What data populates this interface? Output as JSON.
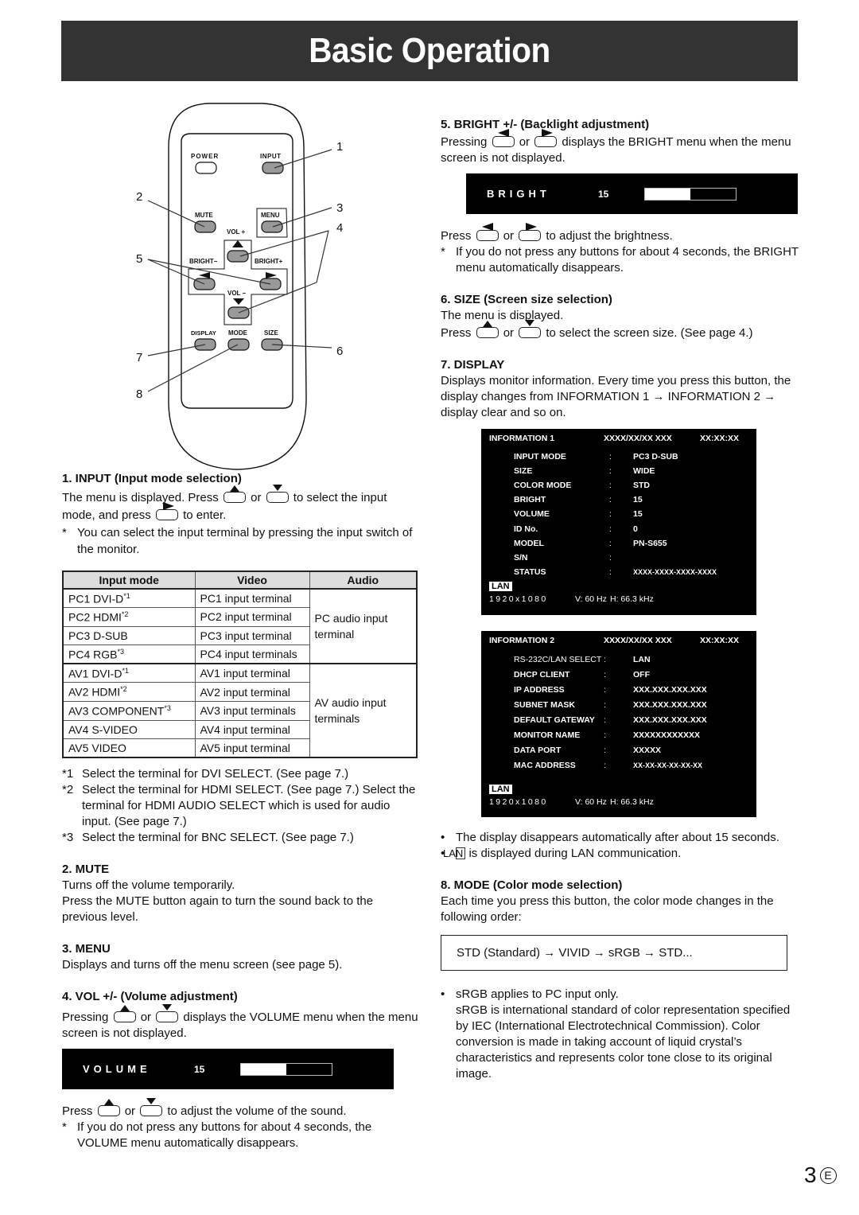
{
  "header": {
    "title": "Basic Operation"
  },
  "remote": {
    "buttons": {
      "power": "POWER",
      "input": "INPUT",
      "mute": "MUTE",
      "menu": "MENU",
      "vol_plus": "VOL +",
      "vol_minus": "VOL −",
      "bright_minus": "BRIGHT−",
      "bright_plus": "BRIGHT+",
      "display": "DISPLAY",
      "mode": "MODE",
      "size": "SIZE"
    },
    "callouts": [
      "1",
      "2",
      "3",
      "4",
      "5",
      "6",
      "7",
      "8"
    ]
  },
  "sections": {
    "input": {
      "heading": "1. INPUT (Input mode selection)",
      "line1_a": "The menu is displayed. Press",
      "or": "or",
      "line1_b": "to select the input",
      "line2_a": "mode, and press",
      "line2_b": "to enter.",
      "note_mark": "*",
      "note": "You can select the input terminal by pressing the input switch of the monitor."
    },
    "table": {
      "headers": [
        "Input mode",
        "Video",
        "Audio"
      ],
      "pc_audio": "PC audio input terminal",
      "av_audio": "AV audio input terminals",
      "rows": [
        {
          "mode": "PC1 DVI-D",
          "sup": "*1",
          "video": "PC1 input terminal"
        },
        {
          "mode": "PC2 HDMI",
          "sup": "*2",
          "video": "PC2 input terminal"
        },
        {
          "mode": "PC3 D-SUB",
          "sup": "",
          "video": "PC3 input terminal"
        },
        {
          "mode": "PC4 RGB",
          "sup": "*3",
          "video": "PC4 input terminals"
        },
        {
          "mode": "AV1 DVI-D",
          "sup": "*1",
          "video": "AV1 input terminal"
        },
        {
          "mode": "AV2 HDMI",
          "sup": "*2",
          "video": "AV2 input terminal"
        },
        {
          "mode": "AV3 COMPONENT",
          "sup": "*3",
          "video": "AV3 input terminals"
        },
        {
          "mode": "AV4 S-VIDEO",
          "sup": "",
          "video": "AV4 input terminal"
        },
        {
          "mode": "AV5 VIDEO",
          "sup": "",
          "video": "AV5 input terminal"
        }
      ]
    },
    "footnotes": [
      {
        "mark": "*1",
        "text": "Select the terminal for DVI SELECT. (See page 7.)"
      },
      {
        "mark": "*2",
        "text": "Select the terminal for HDMI SELECT. (See page 7.) Select the terminal for HDMI AUDIO SELECT which is used for audio input. (See page 7.)"
      },
      {
        "mark": "*3",
        "text": "Select the terminal for BNC SELECT. (See page 7.)"
      }
    ],
    "mute": {
      "heading": "2. MUTE",
      "line1": "Turns off the volume temporarily.",
      "line2": "Press the MUTE button again to turn the sound back to the previous level."
    },
    "menu": {
      "heading": "3. MENU",
      "line1": "Displays and turns off the menu screen (see page 5)."
    },
    "vol": {
      "heading": "4. VOL +/- (Volume adjustment)",
      "p1_a": "Pressing",
      "or": "or",
      "p1_b": "displays the VOLUME menu when the menu screen is not displayed.",
      "osd_label": "VOLUME",
      "osd_value": "15",
      "gauge_fraction": 0.5,
      "p2_a": "Press",
      "p2_b": "to adjust the volume of the sound.",
      "note_mark": "*",
      "note": "If you do not press any buttons for about 4 seconds, the VOLUME menu automatically disappears."
    },
    "bright": {
      "heading": "5. BRIGHT +/- (Backlight adjustment)",
      "p1_a": "Pressing",
      "or": "or",
      "p1_b": "displays the BRIGHT menu when the menu screen is not displayed.",
      "osd_label": "BRIGHT",
      "osd_value": "15",
      "gauge_fraction": 0.5,
      "p2_a": "Press",
      "p2_b": "to adjust the brightness.",
      "note_mark": "*",
      "note": "If you do not press any buttons for about 4 seconds, the BRIGHT menu automatically disappears."
    },
    "size": {
      "heading": "6. SIZE (Screen size selection)",
      "line1": "The menu is displayed.",
      "p2_a": "Press",
      "or": "or",
      "p2_b": "to select the screen size. (See page 4.)"
    },
    "display": {
      "heading": "7. DISPLAY",
      "text": "Displays monitor information. Every time you press this button, the display changes from INFORMATION 1 → INFORMATION 2 → display clear and so on.",
      "info1": {
        "title": "INFORMATION 1",
        "date": "XXXX/XX/XX XXX",
        "time": "XX:XX:XX",
        "rows": [
          {
            "k": "INPUT MODE",
            "v": "PC3 D-SUB"
          },
          {
            "k": "SIZE",
            "v": "WIDE"
          },
          {
            "k": "COLOR MODE",
            "v": "STD"
          },
          {
            "k": "BRIGHT",
            "v": "15"
          },
          {
            "k": "VOLUME",
            "v": "15"
          },
          {
            "k": "ID No.",
            "v": "0"
          },
          {
            "k": "MODEL",
            "v": "PN-S655"
          },
          {
            "k": "S/N",
            "v": ""
          },
          {
            "k": "STATUS",
            "v": "XXXX-XXXX-XXXX-XXXX"
          }
        ],
        "colon": ":",
        "lan": "LAN",
        "resolution": "1920x1080",
        "vfreq": "V: 60 Hz",
        "hfreq": "H: 66.3 kHz"
      },
      "info2": {
        "title": "INFORMATION 2",
        "date": "XXXX/XX/XX XXX",
        "time": "XX:XX:XX",
        "rows": [
          {
            "k": "RS-232C/LAN SELECT",
            "v": "LAN"
          },
          {
            "k": "DHCP CLIENT",
            "v": "OFF"
          },
          {
            "k": "IP ADDRESS",
            "v": "XXX.XXX.XXX.XXX"
          },
          {
            "k": "SUBNET MASK",
            "v": "XXX.XXX.XXX.XXX"
          },
          {
            "k": "DEFAULT GATEWAY",
            "v": "XXX.XXX.XXX.XXX"
          },
          {
            "k": "MONITOR NAME",
            "v": "XXXXXXXXXXXX"
          },
          {
            "k": "DATA PORT",
            "v": "XXXXX"
          },
          {
            "k": "MAC ADDRESS",
            "v": "XX-XX-XX-XX-XX-XX"
          }
        ],
        "colon": ":",
        "lan": "LAN",
        "resolution": "1920x1080",
        "vfreq": "V: 60 Hz",
        "hfreq": "H: 66.3 kHz"
      },
      "bullets": [
        "The display disappears automatically after about 15 seconds.",
        "is displayed during LAN communication."
      ],
      "lan_box": "LAN",
      "bullet_mark": "•"
    },
    "mode": {
      "heading": "8. MODE (Color mode selection)",
      "text": "Each time you press this button, the color mode changes in the following order:",
      "sequence": "STD (Standard) → VIVID → sRGB → STD...",
      "bullet_mark": "•",
      "bullet1": "sRGB applies to PC input only.",
      "bullet1_cont": "sRGB is international standard of color representation specified by IEC (International Electrotechnical Commission). Color conversion is made in taking account of liquid crystal’s characteristics and represents color tone close to its original image."
    }
  },
  "footer": {
    "page": "3",
    "lang": "E"
  }
}
